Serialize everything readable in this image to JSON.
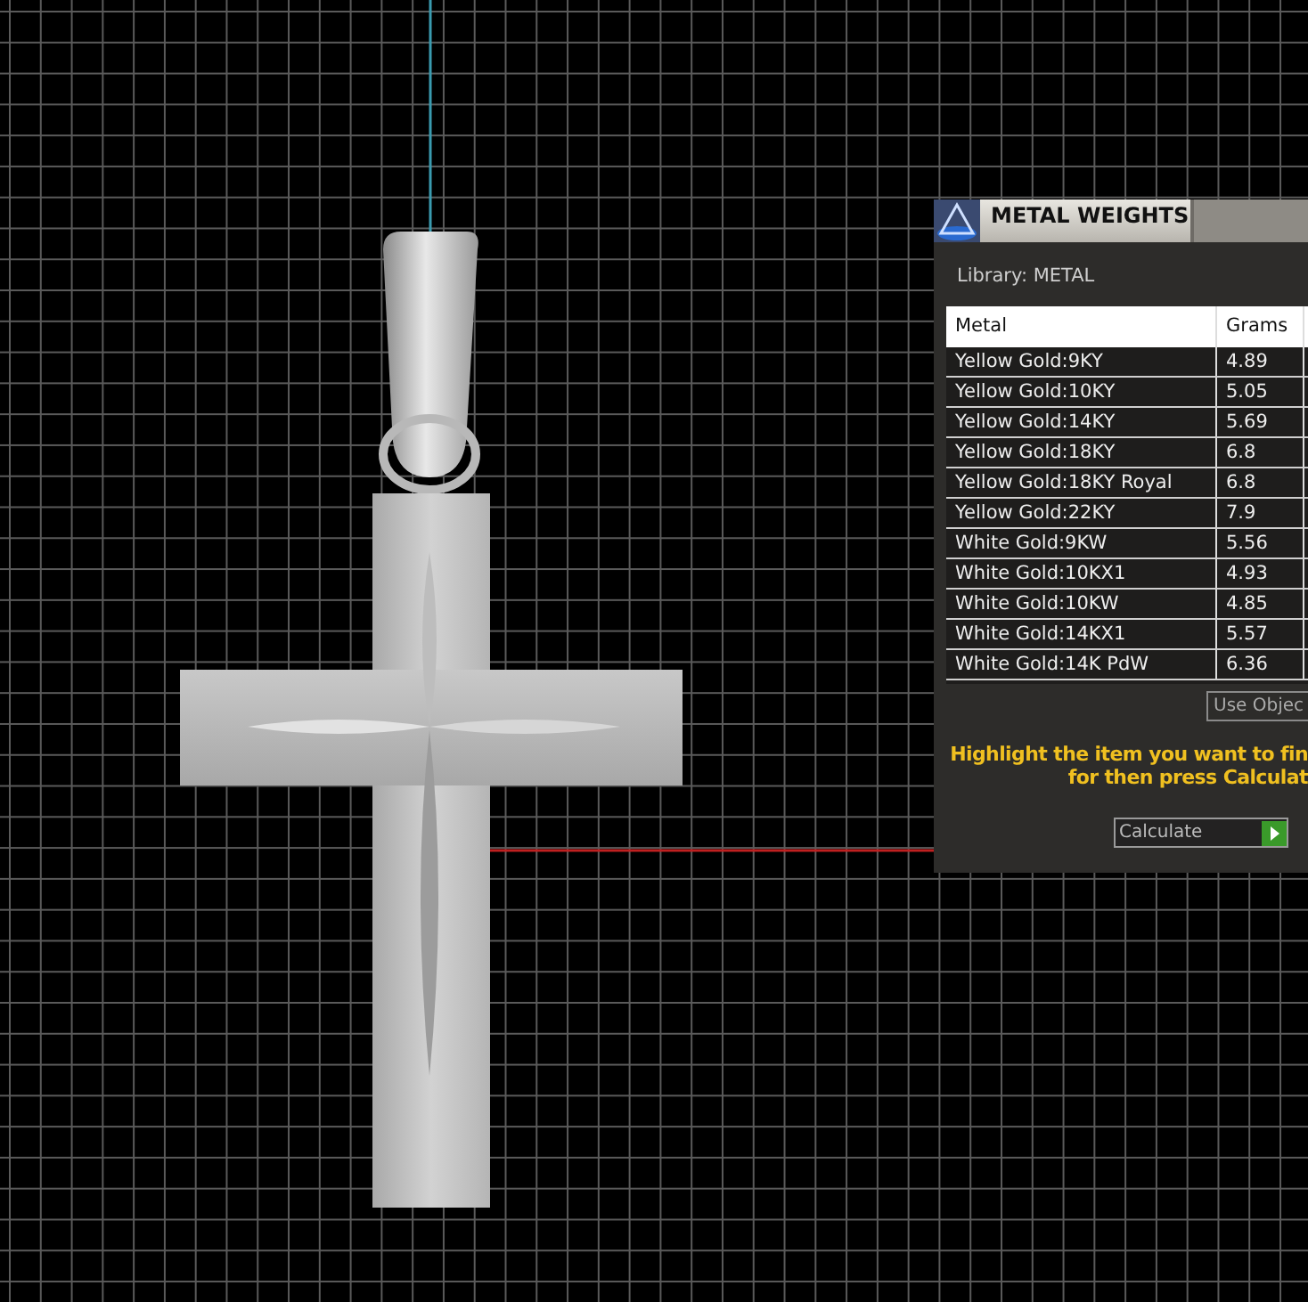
{
  "panel": {
    "title": "METAL WEIGHTS",
    "library_label": "Library: METAL",
    "table": {
      "columns": [
        "Metal",
        "Grams"
      ],
      "rows": [
        {
          "metal": "Yellow Gold:9KY",
          "grams": "4.89"
        },
        {
          "metal": "Yellow Gold:10KY",
          "grams": "5.05"
        },
        {
          "metal": "Yellow Gold:14KY",
          "grams": "5.69"
        },
        {
          "metal": "Yellow Gold:18KY",
          "grams": "6.8"
        },
        {
          "metal": "Yellow Gold:18KY Royal",
          "grams": "6.8"
        },
        {
          "metal": "Yellow Gold:22KY",
          "grams": "7.9"
        },
        {
          "metal": "White Gold:9KW",
          "grams": "5.56"
        },
        {
          "metal": "White Gold:10KX1",
          "grams": "4.93"
        },
        {
          "metal": "White Gold:10KW",
          "grams": "4.85"
        },
        {
          "metal": "White Gold:14KX1",
          "grams": "5.57"
        },
        {
          "metal": "White Gold:14K PdW",
          "grams": "6.36"
        }
      ]
    },
    "use_object_button": "Use Objec",
    "instructions": [
      "Highlight the item you want to fin",
      "for then press Calculat"
    ],
    "calculate_button": "Calculate"
  }
}
